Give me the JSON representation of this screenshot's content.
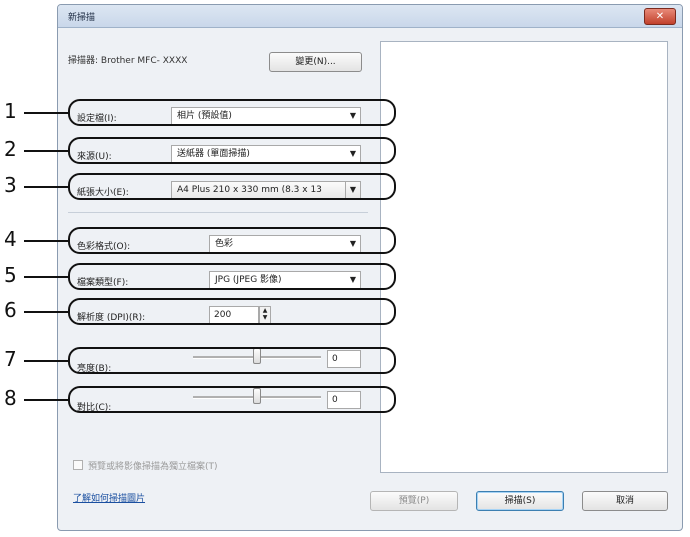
{
  "dialog": {
    "title": "新掃描",
    "scanner_label": "掃描器: Brother MFC- XXXX",
    "change_button": "變更(N)...",
    "close_glyph": "✕"
  },
  "rows": [
    {
      "label": "設定檔(I):",
      "value": "相片 (預設值)"
    },
    {
      "label": "來源(U):",
      "value": "送紙器 (單面掃描)"
    },
    {
      "label": "紙張大小(E):",
      "value": "A4 Plus 210 x 330 mm (8.3 x 13"
    },
    {
      "label": "色彩格式(O):",
      "value": "色彩"
    },
    {
      "label": "檔案類型(F):",
      "value": "JPG (JPEG 影像)"
    },
    {
      "label": "解析度 (DPI)(R):",
      "value": "200"
    },
    {
      "label": "亮度(B):",
      "value": "0",
      "level_percent": 50
    },
    {
      "label": "對比(C):",
      "value": "0",
      "level_percent": 50
    }
  ],
  "checkbox_label": "預覽或將影像掃描為獨立檔案(T)",
  "help_link": "了解如何掃描圖片",
  "buttons": {
    "preview": "預覽(P)",
    "scan": "掃描(S)",
    "cancel": "取消"
  },
  "callouts": [
    "1",
    "2",
    "3",
    "4",
    "5",
    "6",
    "7",
    "8"
  ],
  "icons": {
    "dropdown_arrow": "▼",
    "spin_up": "▲",
    "spin_down": "▼"
  },
  "colors": {
    "window": "#eef1f5",
    "link": "#1a4fa0",
    "close": "#c1412c"
  }
}
